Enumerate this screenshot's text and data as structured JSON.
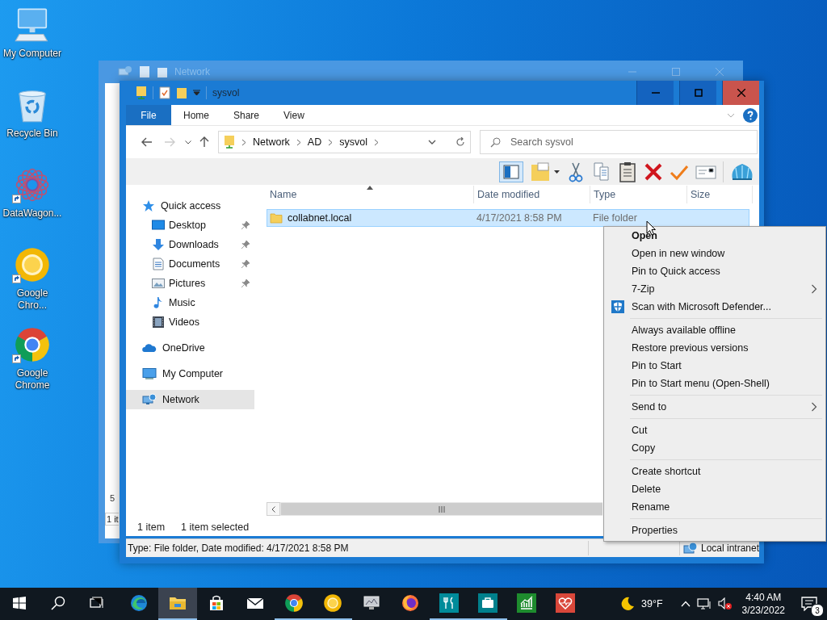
{
  "desktop_icons": [
    {
      "label": "My Computer",
      "kind": "computer",
      "shortcut": false
    },
    {
      "label": "Recycle Bin",
      "kind": "recycle",
      "shortcut": false
    },
    {
      "label": "DataWagon...",
      "kind": "mandala",
      "shortcut": true
    },
    {
      "label": "Google Chro...",
      "kind": "chrome-yellow",
      "shortcut": true
    },
    {
      "label": "Google Chrome",
      "kind": "chrome",
      "shortcut": true
    }
  ],
  "back_window": {
    "title": "Network",
    "fragments": [
      "5",
      "1 it"
    ]
  },
  "window": {
    "title": "sysvol",
    "ribbon_tabs": [
      {
        "label": "File",
        "kind": "menu"
      },
      {
        "label": "Home",
        "kind": "tab"
      },
      {
        "label": "Share",
        "kind": "tab"
      },
      {
        "label": "View",
        "kind": "tab"
      }
    ],
    "address": [
      "Network",
      "AD",
      "sysvol"
    ],
    "search": {
      "placeholder": "Search sysvol"
    },
    "columns": [
      {
        "label": "Name",
        "sorted": true
      },
      {
        "label": "Date modified",
        "sorted": false
      },
      {
        "label": "Type",
        "sorted": false
      },
      {
        "label": "Size",
        "sorted": false
      }
    ],
    "rows": [
      {
        "name": "collabnet.local",
        "date_modified": "4/17/2021 8:58 PM",
        "type": "File folder",
        "selected": true
      }
    ],
    "sidebar": [
      {
        "label": "Quick access",
        "kind": "star",
        "selected": false,
        "children": [
          {
            "label": "Desktop",
            "kind": "desktop",
            "pinned": true,
            "selected": false
          },
          {
            "label": "Downloads",
            "kind": "download",
            "pinned": true,
            "selected": false
          },
          {
            "label": "Documents",
            "kind": "document",
            "pinned": true,
            "selected": false
          },
          {
            "label": "Pictures",
            "kind": "pictures",
            "pinned": true,
            "selected": false
          },
          {
            "label": "Music",
            "kind": "music",
            "pinned": false,
            "selected": false
          },
          {
            "label": "Videos",
            "kind": "videos",
            "pinned": false,
            "selected": false
          }
        ]
      },
      {
        "label": "OneDrive",
        "kind": "cloud",
        "selected": false
      },
      {
        "label": "My Computer",
        "kind": "computer",
        "selected": false
      },
      {
        "label": "Network",
        "kind": "network",
        "selected": true
      }
    ],
    "status": {
      "item_count": "1 item",
      "selection": "1 item selected"
    },
    "details_bar": {
      "text": "Type: File folder, Date modified: 4/17/2021 8:58 PM",
      "zone": "Local intranet"
    }
  },
  "context_menu": {
    "groups": [
      [
        {
          "label": "Open",
          "kind": "plain",
          "default": true,
          "submenu": false
        },
        {
          "label": "Open in new window",
          "kind": "plain",
          "default": false,
          "submenu": false
        },
        {
          "label": "Pin to Quick access",
          "kind": "plain",
          "default": false,
          "submenu": false
        },
        {
          "label": "7-Zip",
          "kind": "plain",
          "default": false,
          "submenu": true
        },
        {
          "label": "Scan with Microsoft Defender...",
          "kind": "shield",
          "default": false,
          "submenu": false
        }
      ],
      [
        {
          "label": "Always available offline",
          "kind": "plain",
          "default": false,
          "submenu": false
        },
        {
          "label": "Restore previous versions",
          "kind": "plain",
          "default": false,
          "submenu": false
        },
        {
          "label": "Pin to Start",
          "kind": "plain",
          "default": false,
          "submenu": false
        },
        {
          "label": "Pin to Start menu (Open-Shell)",
          "kind": "plain",
          "default": false,
          "submenu": false
        }
      ],
      [
        {
          "label": "Send to",
          "kind": "plain",
          "default": false,
          "submenu": true
        }
      ],
      [
        {
          "label": "Cut",
          "kind": "plain",
          "default": false,
          "submenu": false
        },
        {
          "label": "Copy",
          "kind": "plain",
          "default": false,
          "submenu": false
        }
      ],
      [
        {
          "label": "Create shortcut",
          "kind": "plain",
          "default": false,
          "submenu": false
        },
        {
          "label": "Delete",
          "kind": "plain",
          "default": false,
          "submenu": false
        },
        {
          "label": "Rename",
          "kind": "plain",
          "default": false,
          "submenu": false
        }
      ],
      [
        {
          "label": "Properties",
          "kind": "plain",
          "default": false,
          "submenu": false
        }
      ]
    ]
  },
  "taskbar": {
    "apps": [
      {
        "kind": "edge",
        "active": false,
        "running": false
      },
      {
        "kind": "explorer",
        "active": true,
        "running": true
      },
      {
        "kind": "store",
        "active": false,
        "running": false
      },
      {
        "kind": "mail",
        "active": false,
        "running": false
      },
      {
        "kind": "chrome",
        "active": false,
        "running": true
      },
      {
        "kind": "chrome-yellow",
        "active": false,
        "running": true
      },
      {
        "kind": "monitor",
        "active": false,
        "running": false
      },
      {
        "kind": "firefox",
        "active": false,
        "running": false
      },
      {
        "kind": "tile-fork",
        "active": false,
        "running": true
      },
      {
        "kind": "tile-case",
        "active": false,
        "running": true
      },
      {
        "kind": "tile-chart",
        "active": false,
        "running": false
      },
      {
        "kind": "tile-heart",
        "active": false,
        "running": false
      }
    ],
    "weather": "39°F",
    "time": "4:40 AM",
    "date": "3/23/2022",
    "notifications": "3"
  }
}
